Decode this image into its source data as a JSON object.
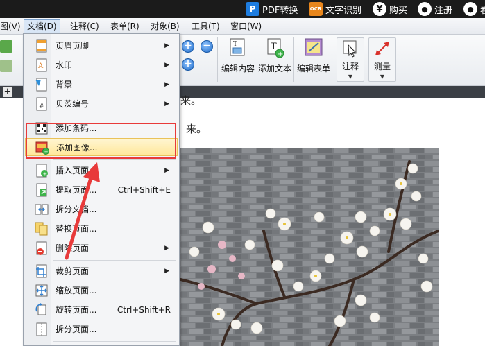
{
  "promo": {
    "pdf_label": "PDF转换",
    "ocr_badge": "OCR",
    "ocr_label": "文字识别",
    "buy_label": "购买",
    "register_label": "注册",
    "trailing": "看"
  },
  "menubar": {
    "view": "图(V)",
    "document": "文档(D)",
    "comment": "注释(C)",
    "form": "表单(R)",
    "object": "对象(B)",
    "tools": "工具(T)",
    "window": "窗口(W)"
  },
  "toolbar": {
    "edit_content": "编辑内容",
    "add_text": "添加文本",
    "edit_form": "编辑表单",
    "comment": "注释",
    "measure": "测量",
    "zoom_in": "+",
    "zoom_out": "−"
  },
  "tabs": {
    "plus": "+"
  },
  "document": {
    "line1": "来。",
    "line2": "来。"
  },
  "dropdown": {
    "items": [
      {
        "label": "页眉页脚",
        "submenu": "▶"
      },
      {
        "label": "水印",
        "submenu": "▶"
      },
      {
        "label": "背景",
        "submenu": "▶"
      },
      {
        "label": "贝茨编号",
        "submenu": "▶"
      },
      {
        "label": "添加条码..."
      },
      {
        "label": "添加图像..."
      },
      {
        "label": "插入页面",
        "submenu": "▶"
      },
      {
        "label": "提取页面...",
        "shortcut": "Ctrl+Shift+E"
      },
      {
        "label": "拆分文档..."
      },
      {
        "label": "替换页面..."
      },
      {
        "label": "删除页面",
        "submenu": "▶"
      },
      {
        "label": "裁剪页面",
        "submenu": "▶"
      },
      {
        "label": "缩放页面..."
      },
      {
        "label": "旋转页面...",
        "shortcut": "Ctrl+Shift+R"
      },
      {
        "label": "拆分页面..."
      }
    ]
  },
  "colors": {
    "annotation_red": "#e83a3a",
    "highlight": "#ffe79a",
    "promo_bg": "#1b1b1b"
  }
}
